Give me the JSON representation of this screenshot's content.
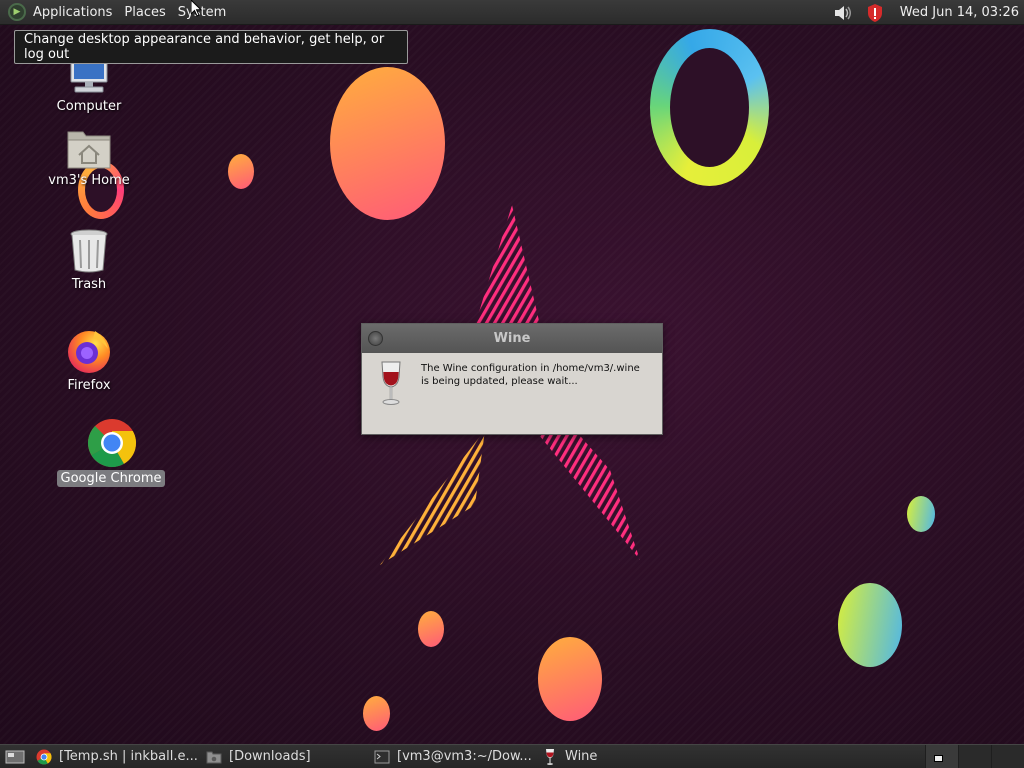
{
  "top_panel": {
    "menus": [
      "Applications",
      "Places",
      "System"
    ],
    "clock": "Wed Jun 14, 03:26",
    "tray": [
      "volume-icon",
      "security-shield-icon"
    ]
  },
  "tooltip": {
    "text": "Change desktop appearance and behavior, get help, or log out"
  },
  "desktop": {
    "icons": [
      {
        "label": "Computer",
        "icon": "computer-icon"
      },
      {
        "label": "vm3's Home",
        "icon": "home-folder-icon"
      },
      {
        "label": "Trash",
        "icon": "trash-icon"
      },
      {
        "label": "Firefox",
        "icon": "firefox-icon"
      },
      {
        "label": "Google Chrome",
        "icon": "chrome-icon",
        "selected": true
      }
    ]
  },
  "dialog": {
    "title": "Wine",
    "message": "The Wine configuration in /home/vm3/.wine is being updated, please wait...",
    "icon": "wine-glass-icon"
  },
  "taskbar": {
    "tasks": [
      {
        "label": "[Temp.sh | inkball.e...",
        "icon": "chrome-icon"
      },
      {
        "label": "[Downloads]",
        "icon": "folder-icon"
      },
      {
        "label": "[vm3@vm3:~/Dow...",
        "icon": "terminal-icon"
      },
      {
        "label": "Wine",
        "icon": "wine-glass-icon"
      }
    ],
    "workspaces": 2,
    "active_workspace": 1
  },
  "colors": {
    "wallpaper_bg": "#2a0f24",
    "panel_bg": "#2b2b2b",
    "dialog_bg": "#d8d5d0",
    "selection": "#7c7c80"
  }
}
